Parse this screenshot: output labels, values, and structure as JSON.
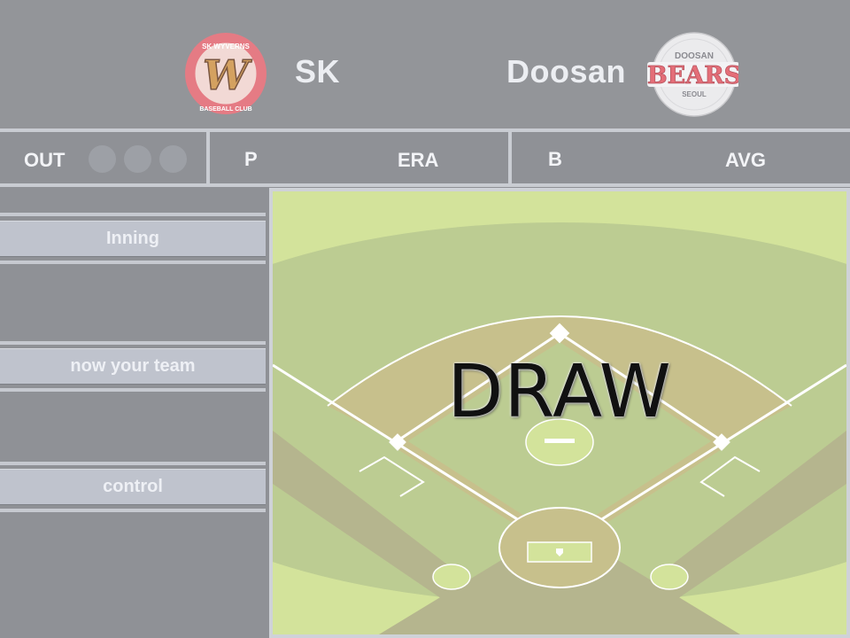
{
  "header": {
    "home_team": {
      "name": "SK",
      "logo_text_top": "SK WYVERNS",
      "logo_letter": "W",
      "logo_text_bottom": "BASEBALL CLUB"
    },
    "away_team": {
      "name": "Doosan",
      "logo_text_top": "DOOSAN",
      "logo_word": "BEARS",
      "logo_text_bottom": "SEOUL"
    }
  },
  "scoreboard": {
    "out_label": "OUT",
    "out_count": 0,
    "pitcher_label": "P",
    "era_label": "ERA",
    "batter_label": "B",
    "avg_label": "AVG"
  },
  "sidebar": {
    "inning_label": "Inning",
    "team_label": "now your team",
    "control_label": "control"
  },
  "field": {
    "overlay_text": "DRAW"
  },
  "colors": {
    "background": "#8f9196",
    "panel_lines": "#c9ccd2",
    "button_bg": "#bfc3cd",
    "grass_outer": "#d3e39b",
    "grass": "#bccc92",
    "infield_dirt": "#c7c08c",
    "sk_red": "#e46e78",
    "doosan_red": "#e46e78"
  }
}
